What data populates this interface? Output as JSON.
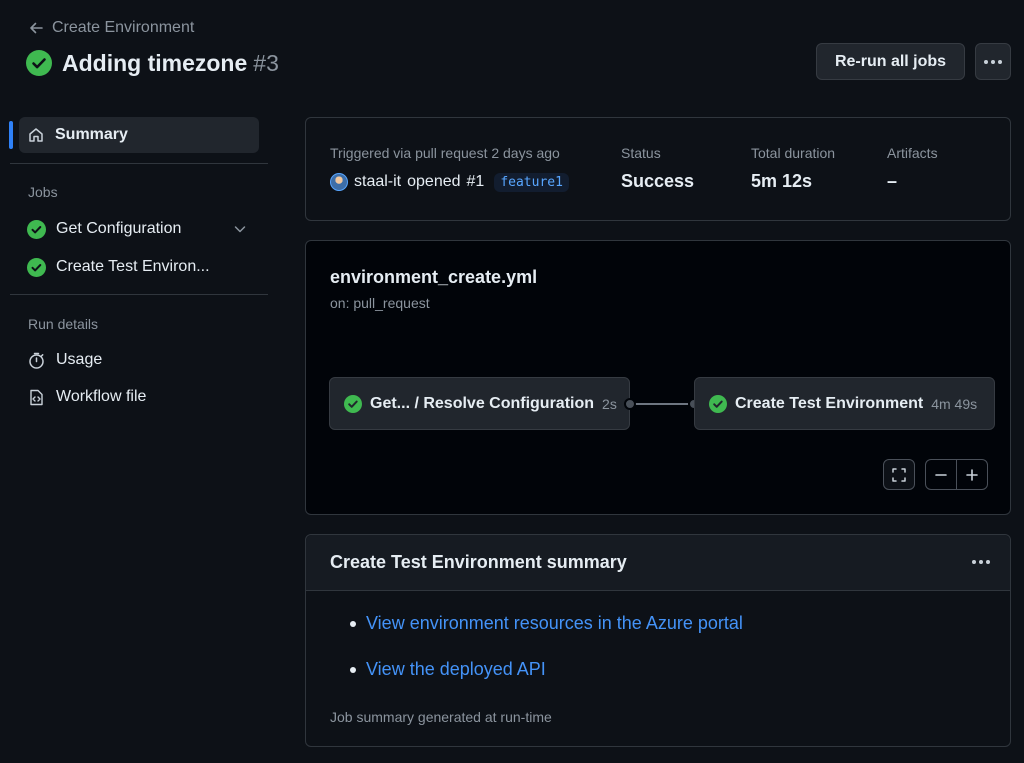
{
  "header": {
    "back_label": "Create Environment",
    "title": "Adding timezone",
    "run_number": "#3",
    "rerun_label": "Re-run all jobs"
  },
  "sidebar": {
    "summary_label": "Summary",
    "jobs_heading": "Jobs",
    "jobs": [
      {
        "label": "Get Configuration"
      },
      {
        "label": "Create Test Environ..."
      }
    ],
    "run_details_heading": "Run details",
    "details": [
      {
        "label": "Usage"
      },
      {
        "label": "Workflow file"
      }
    ]
  },
  "run_info": {
    "trigger_label": "Triggered via pull request 2 days ago",
    "actor": "staal-it",
    "opened_text": "opened",
    "pr_number": "#1",
    "branch": "feature1",
    "status_label": "Status",
    "status_value": "Success",
    "duration_label": "Total duration",
    "duration_value": "5m 12s",
    "artifacts_label": "Artifacts",
    "artifacts_value": "–"
  },
  "workflow": {
    "file_name": "environment_create.yml",
    "trigger": "on: pull_request",
    "jobs": [
      {
        "label": "Get... / Resolve Configuration",
        "duration": "2s"
      },
      {
        "label": "Create Test Environment",
        "duration": "4m 49s"
      }
    ]
  },
  "summary": {
    "title": "Create Test Environment summary",
    "links": [
      {
        "label": "View environment resources in the Azure portal"
      },
      {
        "label": "View the deployed API"
      }
    ],
    "footer": "Job summary generated at run-time"
  },
  "colors": {
    "success": "#3fb950",
    "accent": "#2f81f7",
    "link": "#4493f8"
  }
}
